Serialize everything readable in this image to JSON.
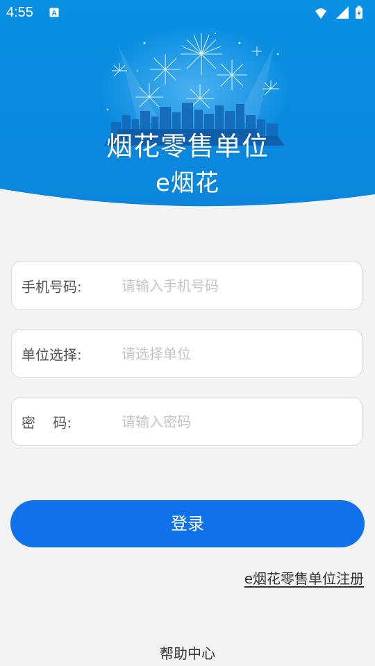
{
  "status_bar": {
    "time": "4:55",
    "notification_icon": "a-square-icon",
    "wifi_icon": "wifi-icon",
    "signal_icon": "cellular-signal-icon",
    "battery_icon": "battery-charging-icon"
  },
  "header": {
    "title": "烟花零售单位",
    "subtitle": "e烟花",
    "illustration": "fireworks-cityscape-illustration",
    "background_color": "#0a8de0"
  },
  "form": {
    "phone": {
      "label": "手机号码:",
      "placeholder": "请输入手机号码",
      "value": ""
    },
    "unit": {
      "label": "单位选择:",
      "placeholder": "请选择单位",
      "value": ""
    },
    "password": {
      "label": "密    码:",
      "placeholder": "请输入密码",
      "value": ""
    }
  },
  "actions": {
    "login_label": "登录",
    "register_link": "e烟花零售单位注册",
    "help_link": "帮助中心"
  },
  "colors": {
    "accent": "#0f72ea",
    "header_blue": "#0a8de0",
    "background": "#f3f3f3"
  }
}
